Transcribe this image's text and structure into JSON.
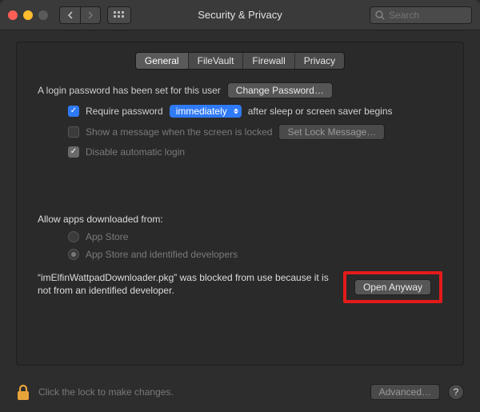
{
  "window": {
    "title": "Security & Privacy",
    "search_placeholder": "Search"
  },
  "tabs": {
    "general": "General",
    "filevault": "FileVault",
    "firewall": "Firewall",
    "privacy": "Privacy"
  },
  "login": {
    "set_text": "A login password has been set for this user",
    "change_btn": "Change Password…",
    "require_label": "Require password",
    "delay": "immediately",
    "after_text": "after sleep or screen saver begins",
    "show_msg": "Show a message when the screen is locked",
    "set_lock_btn": "Set Lock Message…",
    "disable_auto": "Disable automatic login"
  },
  "allow": {
    "title": "Allow apps downloaded from:",
    "opt1": "App Store",
    "opt2": "App Store and identified developers",
    "blocked_msg": "“imElfinWattpadDownloader.pkg” was blocked from use because it is not from an identified developer.",
    "open_anyway": "Open Anyway"
  },
  "footer": {
    "lock_text": "Click the lock to make changes.",
    "advanced": "Advanced…"
  }
}
